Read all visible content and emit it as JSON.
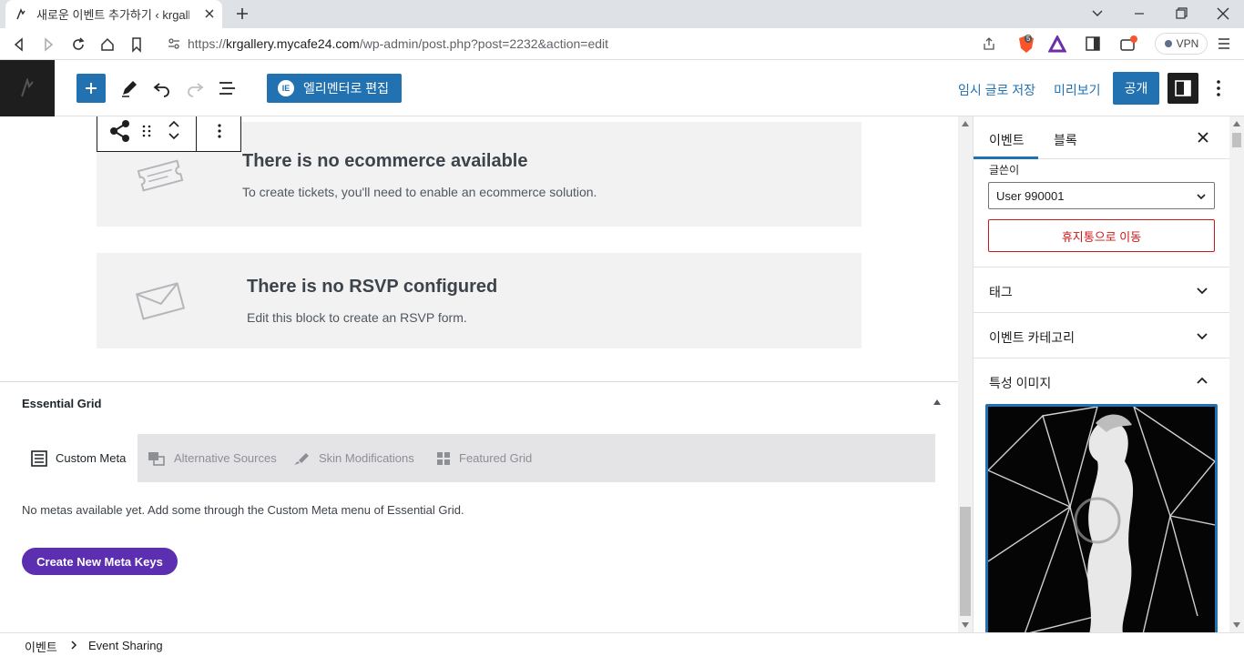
{
  "browser": {
    "tab_title": "새로운 이벤트 추가하기 ‹ krgallery",
    "url_prefix": "https://",
    "url_host": "krgallery.mycafe24.com",
    "url_path": "/wp-admin/post.php?post=2232&action=edit",
    "vpn_label": "VPN",
    "brave_badge": "5"
  },
  "header": {
    "elementor_button": "엘리멘터로 편집",
    "elementor_icon": "IE",
    "save_draft": "임시 글로 저장",
    "preview": "미리보기",
    "publish": "공개"
  },
  "blocks": {
    "tickets_title": "There is no ecommerce available",
    "tickets_desc": "To create tickets, you'll need to enable an ecommerce solution.",
    "rsvp_title": "There is no RSVP configured",
    "rsvp_desc": "Edit this block to create an RSVP form."
  },
  "essential_grid": {
    "title": "Essential Grid",
    "tabs": [
      {
        "label": "Custom Meta",
        "active": true
      },
      {
        "label": "Alternative Sources",
        "active": false
      },
      {
        "label": "Skin Modifications",
        "active": false
      },
      {
        "label": "Featured Grid",
        "active": false
      }
    ],
    "info": "No metas available yet. Add some through the Custom Meta menu of Essential Grid.",
    "create_button": "Create New Meta Keys",
    "button_color": "#5b2fb0"
  },
  "sidebar": {
    "tab_event": "이벤트",
    "tab_block": "블록",
    "author_label": "글쓴이",
    "author_value": "User 990001",
    "trash_button": "휴지통으로 이동",
    "sections": [
      "태그",
      "이벤트 카테고리",
      "특성 이미지"
    ]
  },
  "footer": {
    "crumb_root": "이벤트",
    "crumb_current": "Event Sharing"
  },
  "colors": {
    "accent": "#2271b1",
    "danger": "#cc1818"
  }
}
